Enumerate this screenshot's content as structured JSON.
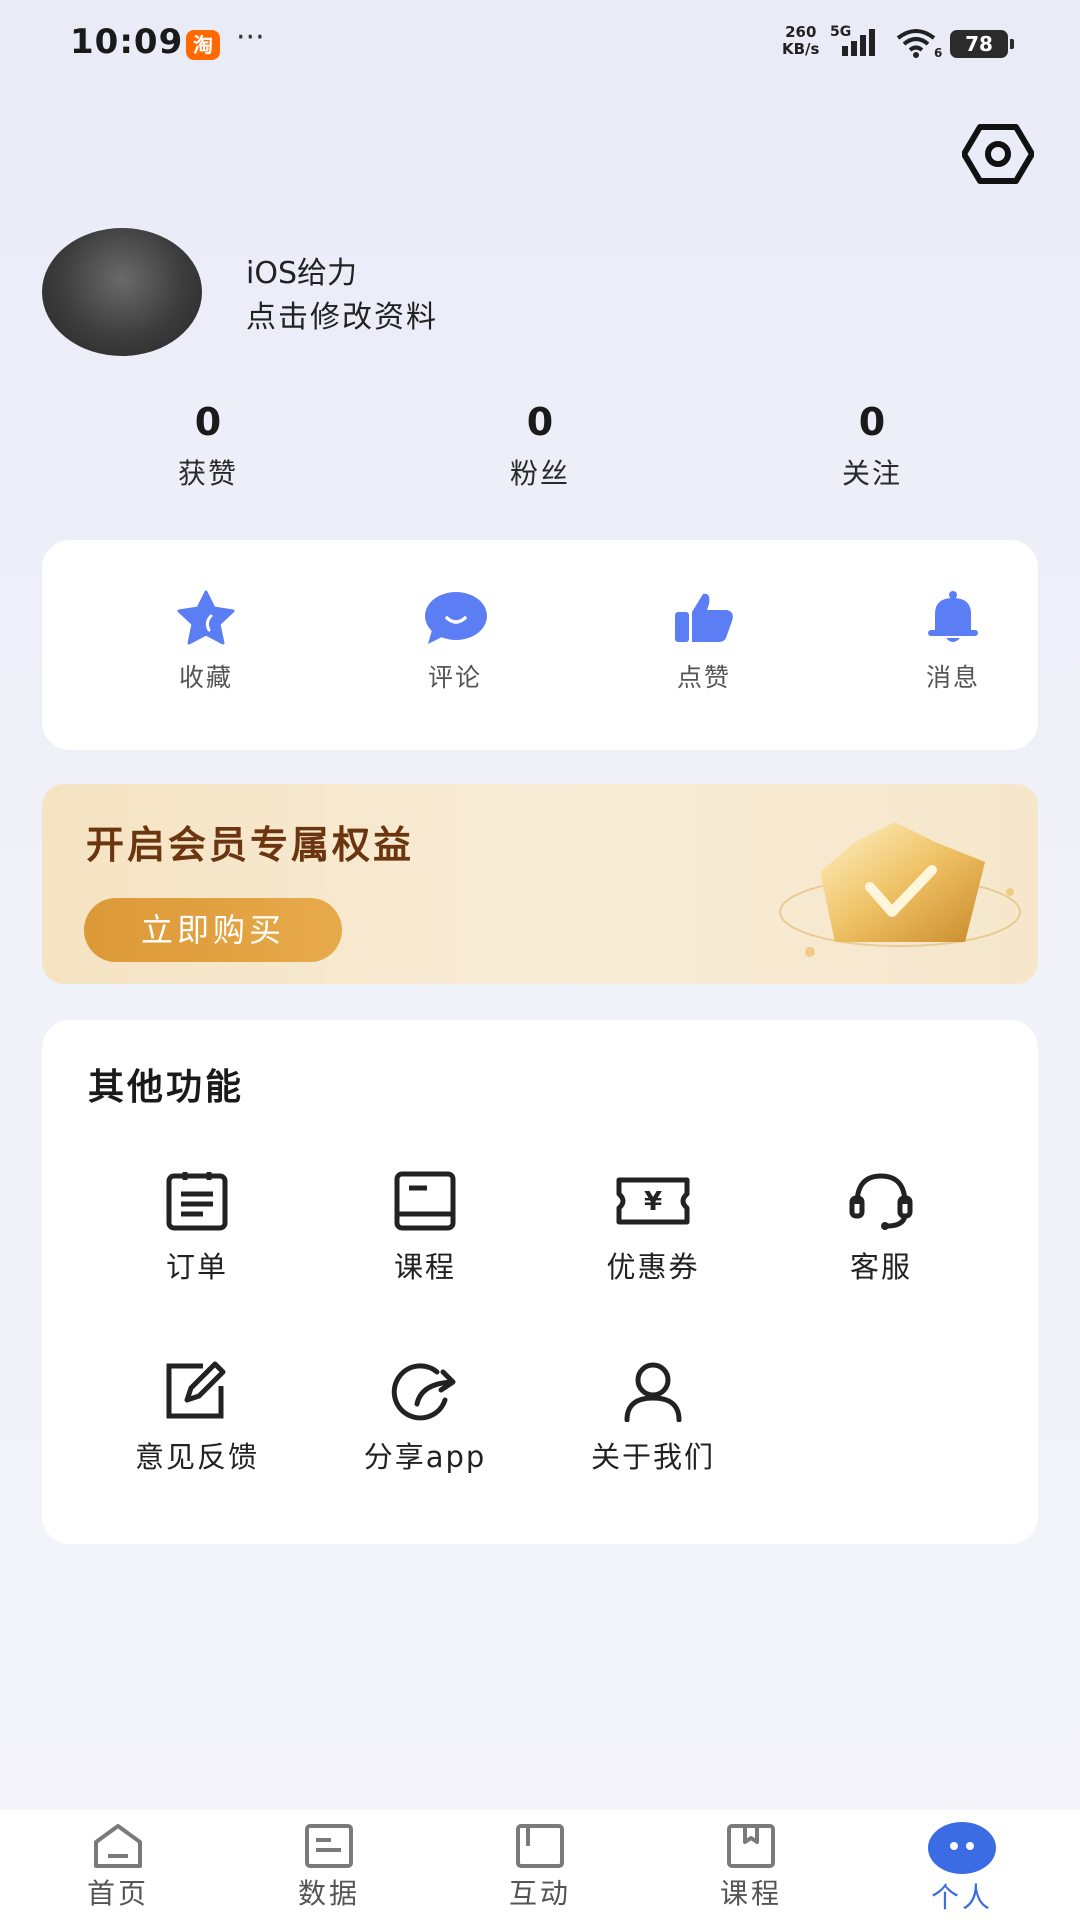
{
  "status_bar": {
    "time": "10:09",
    "app_badge": "淘",
    "more": "···",
    "net_speed_value": "260",
    "net_speed_unit": "KB/s",
    "network": "5G",
    "wifi_sub": "6",
    "battery": "78"
  },
  "profile": {
    "name": "iOS给力",
    "edit_label": "点击修改资料"
  },
  "stats": [
    {
      "value": "0",
      "label": "获赞"
    },
    {
      "value": "0",
      "label": "粉丝"
    },
    {
      "value": "0",
      "label": "关注"
    }
  ],
  "quick_actions": [
    {
      "label": "收藏",
      "icon": "star-icon"
    },
    {
      "label": "评论",
      "icon": "comment-icon"
    },
    {
      "label": "点赞",
      "icon": "thumbs-up-icon"
    },
    {
      "label": "消息",
      "icon": "bell-icon"
    }
  ],
  "vip": {
    "title": "开启会员专属权益",
    "button": "立即购买",
    "icon": "crown-icon"
  },
  "other": {
    "title": "其他功能",
    "items": [
      {
        "label": "订单",
        "icon": "order-list-icon"
      },
      {
        "label": "课程",
        "icon": "book-icon"
      },
      {
        "label": "优惠券",
        "icon": "coupon-icon"
      },
      {
        "label": "客服",
        "icon": "headset-icon"
      },
      {
        "label": "意见反馈",
        "icon": "feedback-edit-icon"
      },
      {
        "label": "分享app",
        "icon": "share-icon"
      },
      {
        "label": "关于我们",
        "icon": "user-icon"
      }
    ]
  },
  "tabs": [
    {
      "label": "首页",
      "icon": "home-icon"
    },
    {
      "label": "数据",
      "icon": "data-icon"
    },
    {
      "label": "互动",
      "icon": "interact-icon"
    },
    {
      "label": "课程",
      "icon": "course-icon"
    },
    {
      "label": "个人",
      "icon": "profile-icon",
      "active": true
    }
  ],
  "colors": {
    "accent_blue": "#3c6ce3",
    "icon_blue": "#5b7ef5",
    "vip_button": "#dc9836",
    "vip_title": "#6b3510"
  }
}
